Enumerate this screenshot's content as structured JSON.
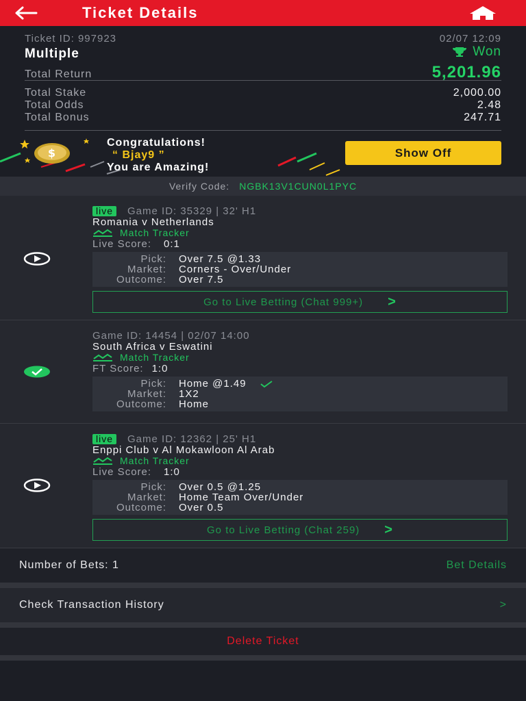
{
  "header": {
    "title": "Ticket Details"
  },
  "ticket": {
    "id_label": "Ticket ID: 997923",
    "datetime": "02/07 12:09",
    "type": "Multiple",
    "status": "Won",
    "total_return_label": "Total Return",
    "total_return": "5,201.96",
    "total_stake_label": "Total Stake",
    "total_stake": "2,000.00",
    "total_odds_label": "Total Odds",
    "total_odds": "2.48",
    "total_bonus_label": "Total Bonus",
    "total_bonus": "247.71"
  },
  "congrats": {
    "line1": "Congratulations!",
    "user": "“ Bjay9 ”",
    "line3": "You are Amazing!",
    "button": "Show Off"
  },
  "verify": {
    "label": "Verify Code:",
    "code": "NGBK13V1CUN0L1PYC"
  },
  "matches": [
    {
      "live_badge": "live",
      "game_line": "Game ID: 35329 | 32' H1",
      "teams": "Romania v Netherlands",
      "tracker": "Match Tracker",
      "score_label": "Live Score:",
      "score": "0:1",
      "pick_label": "Pick:",
      "pick": "Over 7.5 @1.33",
      "market_label": "Market:",
      "market": "Corners - Over/Under",
      "outcome_label": "Outcome:",
      "outcome": "Over 7.5",
      "live_button": "Go to Live Betting (Chat 999+)"
    },
    {
      "game_line": "Game ID: 14454 | 02/07 14:00",
      "teams": "South Africa v Eswatini",
      "tracker": "Match Tracker",
      "score_label": "FT Score:",
      "score": "1:0",
      "pick_label": "Pick:",
      "pick": "Home @1.49",
      "market_label": "Market:",
      "market": "1X2",
      "outcome_label": "Outcome:",
      "outcome": "Home"
    },
    {
      "live_badge": "live",
      "game_line": "Game ID: 12362 | 25' H1",
      "teams": "Enppi Club v Al Mokawloon Al Arab",
      "tracker": "Match Tracker",
      "score_label": "Live Score:",
      "score": "1:0",
      "pick_label": "Pick:",
      "pick": "Over 0.5 @1.25",
      "market_label": "Market:",
      "market": "Home Team Over/Under",
      "outcome_label": "Outcome:",
      "outcome": "Over 0.5",
      "live_button": "Go to Live Betting (Chat 259)"
    }
  ],
  "footer": {
    "bets_label": "Number of Bets: 1",
    "bet_details": "Bet Details",
    "history": "Check Transaction History",
    "history_chevron": ">",
    "delete": "Delete Ticket"
  },
  "colors": {
    "brand_red": "#e41827",
    "win_green": "#22c55e",
    "accent_yellow": "#f5c518"
  }
}
